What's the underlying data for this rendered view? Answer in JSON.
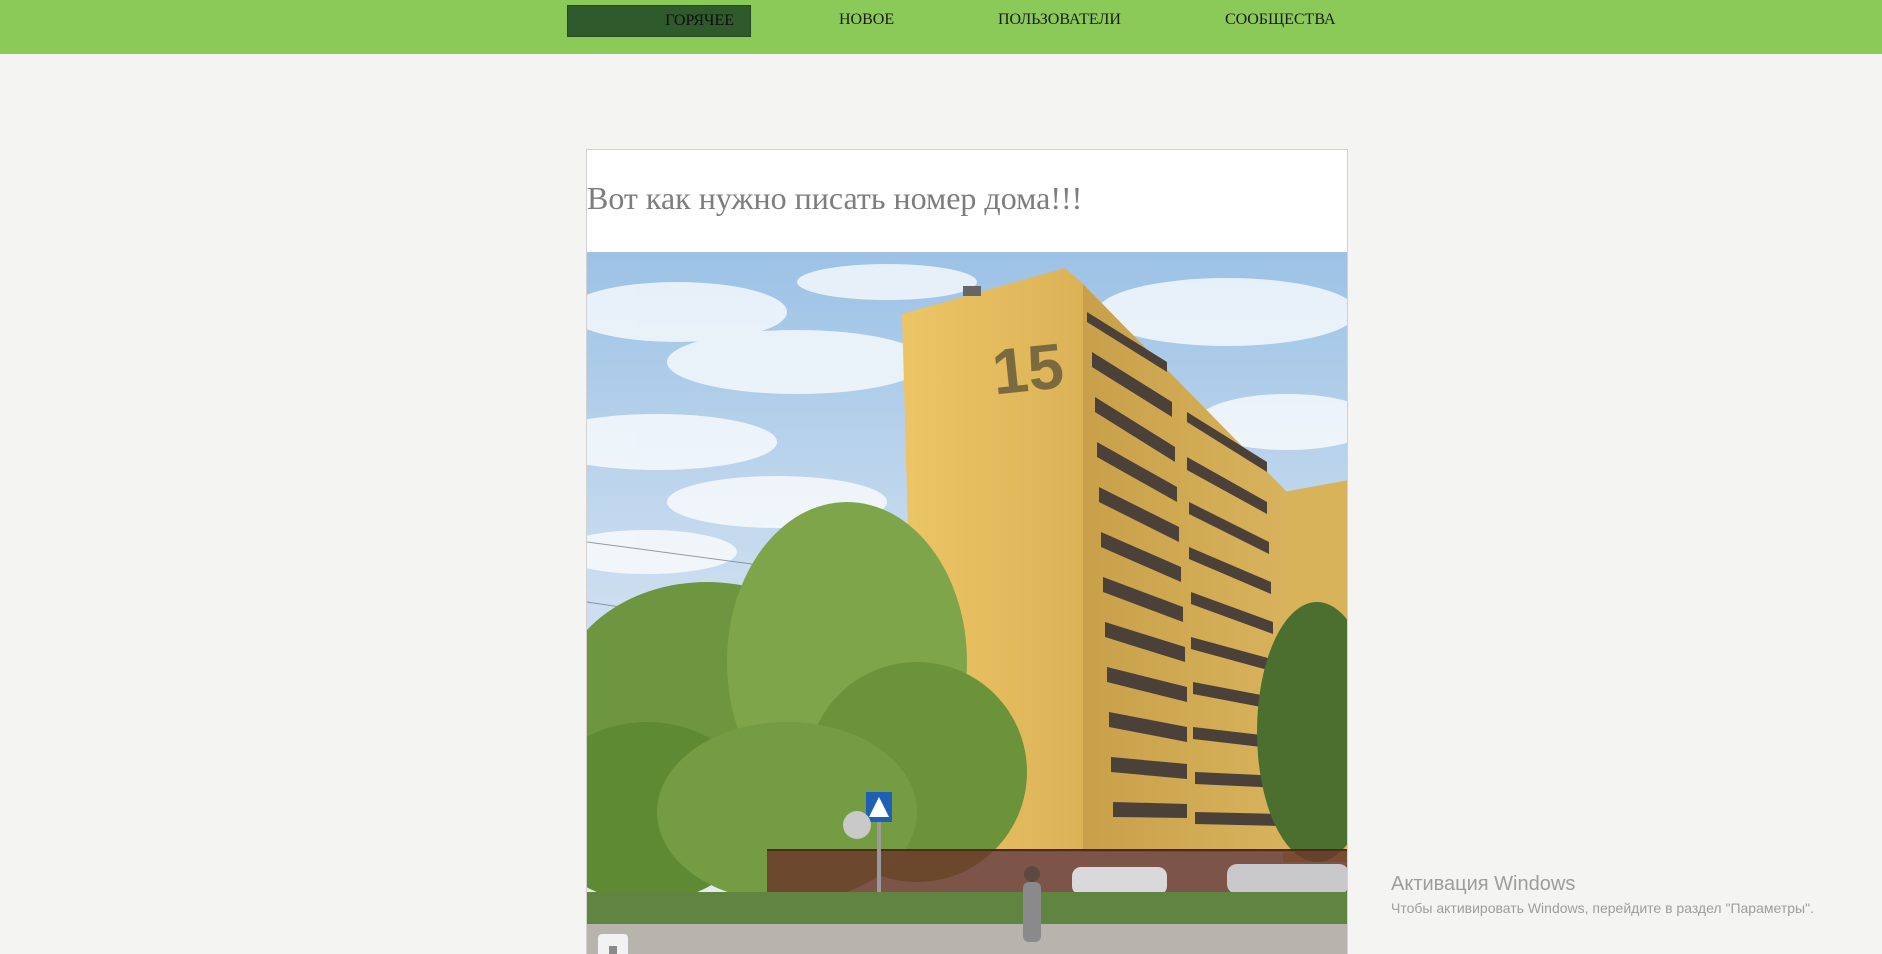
{
  "nav": {
    "items": [
      {
        "label": "ГОРЯЧЕЕ"
      },
      {
        "label": "НОВОЕ"
      },
      {
        "label": "ПОЛЬЗОВАТЕЛИ"
      },
      {
        "label": "СООБЩЕСТВА"
      }
    ],
    "active_index": 0
  },
  "post": {
    "title": "Вот как нужно писать номер дома!!!",
    "image": {
      "painted_number": "15"
    }
  },
  "windows_activation": {
    "title": "Активация Windows",
    "subtitle": "Чтобы активировать Windows, перейдите в раздел \"Параметры\"."
  },
  "colors": {
    "topbar": "#8bca58",
    "nav_active": "#2f5a2b",
    "page_background": "#f4f5f2",
    "building": "#e8bf5f"
  }
}
